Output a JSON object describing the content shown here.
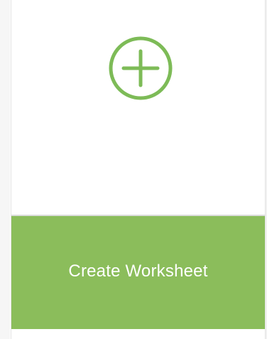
{
  "card": {
    "icon": "plus-circle-icon",
    "label": "Create Worksheet"
  },
  "colors": {
    "accent": "#8bbd5b",
    "icon": "#7dbb57"
  }
}
